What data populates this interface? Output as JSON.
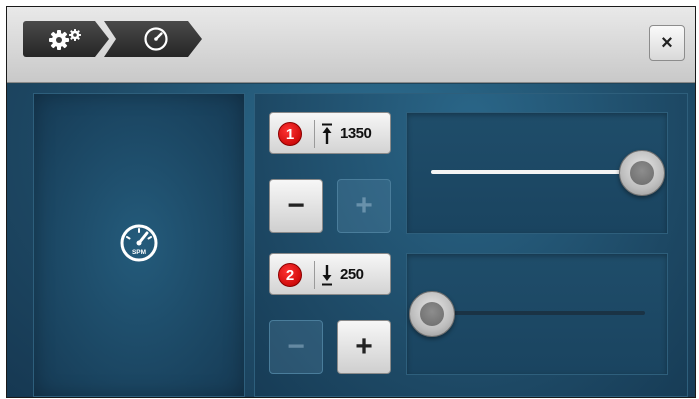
{
  "toolbar": {
    "crumbs": [
      {
        "icon": "gears-icon"
      },
      {
        "icon": "speedometer-icon"
      }
    ],
    "close_label": "×"
  },
  "left_panel": {
    "icon": "spm-speedometer-icon",
    "icon_label": "SPM"
  },
  "upper": {
    "badge": "1",
    "icon": "max-limit-arrow-icon",
    "value": "1350",
    "minus_label": "−",
    "plus_label": "+",
    "minus_enabled": true,
    "plus_enabled": false,
    "slider_fraction": 1.0
  },
  "lower": {
    "badge": "2",
    "icon": "min-limit-arrow-icon",
    "value": "250",
    "minus_label": "−",
    "plus_label": "+",
    "minus_enabled": false,
    "plus_enabled": true,
    "slider_fraction": 0.0
  },
  "colors": {
    "badge": "#d10d0d",
    "background": "#20455a"
  }
}
